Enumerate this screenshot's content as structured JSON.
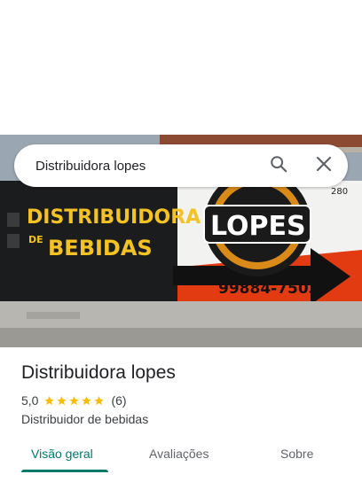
{
  "search": {
    "query": "Distribuidora lopes"
  },
  "photo": {
    "wall_text_line1": "DISTRIBUIDORA",
    "wall_text_de": "DE",
    "wall_text_line2": "BEBIDAS",
    "logo_text": "LOPES",
    "phone": "99884-7503",
    "house_number": "280"
  },
  "place": {
    "name": "Distribuidora lopes",
    "rating": "5,0",
    "stars": 5,
    "review_count": "(6)",
    "category": "Distribuidor de bebidas"
  },
  "tabs": [
    {
      "label": "Visão geral",
      "active": true
    },
    {
      "label": "Avaliações",
      "active": false
    },
    {
      "label": "Sobre",
      "active": false
    }
  ],
  "colors": {
    "accent": "#00796b",
    "star": "#fbbc04"
  }
}
